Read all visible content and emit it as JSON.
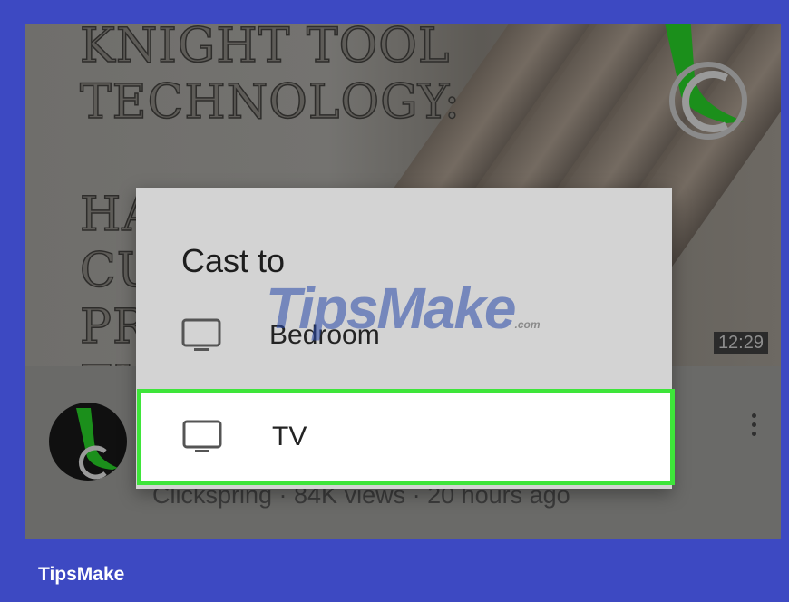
{
  "video": {
    "thumbnail_title": "KNIGHT TOOL\nTECHNOLOGY:\n\nHAND\nCU\nPR\nFI",
    "duration": "12:29",
    "meta": "Clickspring · 84K views · 20 hours ago"
  },
  "cast_dialog": {
    "title": "Cast to",
    "devices": [
      {
        "label": "Bedroom",
        "icon": "tv-icon"
      },
      {
        "label": "TV",
        "icon": "tv-icon",
        "highlighted": true
      }
    ]
  },
  "watermark": {
    "text": "TipsMake",
    "suffix": ".com"
  },
  "brand": "TipsMake",
  "colors": {
    "frame": "#3d49c2",
    "highlight": "#3ee53a",
    "dialog_bg": "#d3d3d3"
  }
}
